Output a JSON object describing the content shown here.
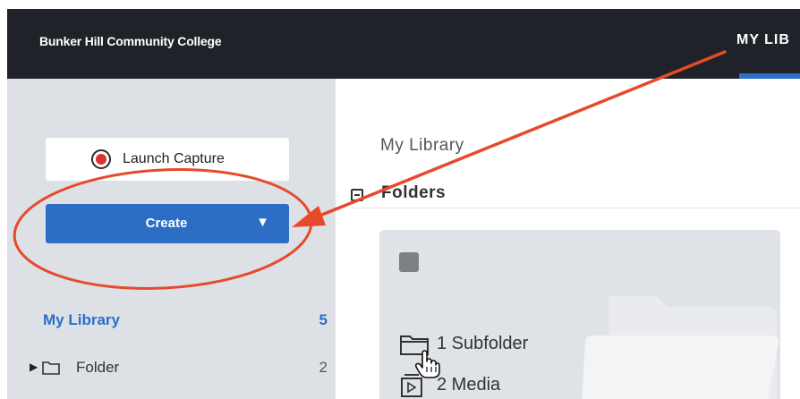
{
  "header": {
    "brand": "Bunker Hill Community College",
    "active_tab": "MY LIB"
  },
  "sidebar": {
    "launch_capture_label": "Launch Capture",
    "create_label": "Create",
    "create_caret": "▼",
    "library": {
      "label": "My Library",
      "count": "5"
    },
    "folder": {
      "caret": "▶",
      "label": "Folder",
      "count": "2"
    }
  },
  "main": {
    "breadcrumb": "My Library",
    "section_title": "Folders",
    "card": {
      "subfolders_label": "1 Subfolder",
      "media_label": "2 Media"
    }
  },
  "colors": {
    "topbar": "#1f2228",
    "accent_blue": "#2c6dc6",
    "sidebar_bg": "#dde0e5",
    "annotation_red": "#e54a2b"
  },
  "icons": [
    "record-icon",
    "dropdown-caret-icon",
    "collapse-icon",
    "folder-icon",
    "media-icon",
    "hand-cursor-icon"
  ]
}
